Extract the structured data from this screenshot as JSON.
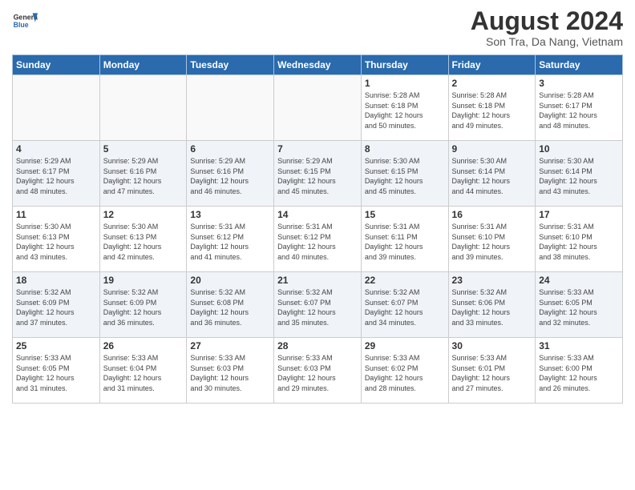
{
  "header": {
    "logo_line1": "General",
    "logo_line2": "Blue",
    "month_year": "August 2024",
    "location": "Son Tra, Da Nang, Vietnam"
  },
  "weekdays": [
    "Sunday",
    "Monday",
    "Tuesday",
    "Wednesday",
    "Thursday",
    "Friday",
    "Saturday"
  ],
  "weeks": [
    [
      {
        "day": "",
        "info": ""
      },
      {
        "day": "",
        "info": ""
      },
      {
        "day": "",
        "info": ""
      },
      {
        "day": "",
        "info": ""
      },
      {
        "day": "1",
        "info": "Sunrise: 5:28 AM\nSunset: 6:18 PM\nDaylight: 12 hours\nand 50 minutes."
      },
      {
        "day": "2",
        "info": "Sunrise: 5:28 AM\nSunset: 6:18 PM\nDaylight: 12 hours\nand 49 minutes."
      },
      {
        "day": "3",
        "info": "Sunrise: 5:28 AM\nSunset: 6:17 PM\nDaylight: 12 hours\nand 48 minutes."
      }
    ],
    [
      {
        "day": "4",
        "info": "Sunrise: 5:29 AM\nSunset: 6:17 PM\nDaylight: 12 hours\nand 48 minutes."
      },
      {
        "day": "5",
        "info": "Sunrise: 5:29 AM\nSunset: 6:16 PM\nDaylight: 12 hours\nand 47 minutes."
      },
      {
        "day": "6",
        "info": "Sunrise: 5:29 AM\nSunset: 6:16 PM\nDaylight: 12 hours\nand 46 minutes."
      },
      {
        "day": "7",
        "info": "Sunrise: 5:29 AM\nSunset: 6:15 PM\nDaylight: 12 hours\nand 45 minutes."
      },
      {
        "day": "8",
        "info": "Sunrise: 5:30 AM\nSunset: 6:15 PM\nDaylight: 12 hours\nand 45 minutes."
      },
      {
        "day": "9",
        "info": "Sunrise: 5:30 AM\nSunset: 6:14 PM\nDaylight: 12 hours\nand 44 minutes."
      },
      {
        "day": "10",
        "info": "Sunrise: 5:30 AM\nSunset: 6:14 PM\nDaylight: 12 hours\nand 43 minutes."
      }
    ],
    [
      {
        "day": "11",
        "info": "Sunrise: 5:30 AM\nSunset: 6:13 PM\nDaylight: 12 hours\nand 43 minutes."
      },
      {
        "day": "12",
        "info": "Sunrise: 5:30 AM\nSunset: 6:13 PM\nDaylight: 12 hours\nand 42 minutes."
      },
      {
        "day": "13",
        "info": "Sunrise: 5:31 AM\nSunset: 6:12 PM\nDaylight: 12 hours\nand 41 minutes."
      },
      {
        "day": "14",
        "info": "Sunrise: 5:31 AM\nSunset: 6:12 PM\nDaylight: 12 hours\nand 40 minutes."
      },
      {
        "day": "15",
        "info": "Sunrise: 5:31 AM\nSunset: 6:11 PM\nDaylight: 12 hours\nand 39 minutes."
      },
      {
        "day": "16",
        "info": "Sunrise: 5:31 AM\nSunset: 6:10 PM\nDaylight: 12 hours\nand 39 minutes."
      },
      {
        "day": "17",
        "info": "Sunrise: 5:31 AM\nSunset: 6:10 PM\nDaylight: 12 hours\nand 38 minutes."
      }
    ],
    [
      {
        "day": "18",
        "info": "Sunrise: 5:32 AM\nSunset: 6:09 PM\nDaylight: 12 hours\nand 37 minutes."
      },
      {
        "day": "19",
        "info": "Sunrise: 5:32 AM\nSunset: 6:09 PM\nDaylight: 12 hours\nand 36 minutes."
      },
      {
        "day": "20",
        "info": "Sunrise: 5:32 AM\nSunset: 6:08 PM\nDaylight: 12 hours\nand 36 minutes."
      },
      {
        "day": "21",
        "info": "Sunrise: 5:32 AM\nSunset: 6:07 PM\nDaylight: 12 hours\nand 35 minutes."
      },
      {
        "day": "22",
        "info": "Sunrise: 5:32 AM\nSunset: 6:07 PM\nDaylight: 12 hours\nand 34 minutes."
      },
      {
        "day": "23",
        "info": "Sunrise: 5:32 AM\nSunset: 6:06 PM\nDaylight: 12 hours\nand 33 minutes."
      },
      {
        "day": "24",
        "info": "Sunrise: 5:33 AM\nSunset: 6:05 PM\nDaylight: 12 hours\nand 32 minutes."
      }
    ],
    [
      {
        "day": "25",
        "info": "Sunrise: 5:33 AM\nSunset: 6:05 PM\nDaylight: 12 hours\nand 31 minutes."
      },
      {
        "day": "26",
        "info": "Sunrise: 5:33 AM\nSunset: 6:04 PM\nDaylight: 12 hours\nand 31 minutes."
      },
      {
        "day": "27",
        "info": "Sunrise: 5:33 AM\nSunset: 6:03 PM\nDaylight: 12 hours\nand 30 minutes."
      },
      {
        "day": "28",
        "info": "Sunrise: 5:33 AM\nSunset: 6:03 PM\nDaylight: 12 hours\nand 29 minutes."
      },
      {
        "day": "29",
        "info": "Sunrise: 5:33 AM\nSunset: 6:02 PM\nDaylight: 12 hours\nand 28 minutes."
      },
      {
        "day": "30",
        "info": "Sunrise: 5:33 AM\nSunset: 6:01 PM\nDaylight: 12 hours\nand 27 minutes."
      },
      {
        "day": "31",
        "info": "Sunrise: 5:33 AM\nSunset: 6:00 PM\nDaylight: 12 hours\nand 26 minutes."
      }
    ]
  ],
  "alt_rows": [
    1,
    3
  ]
}
